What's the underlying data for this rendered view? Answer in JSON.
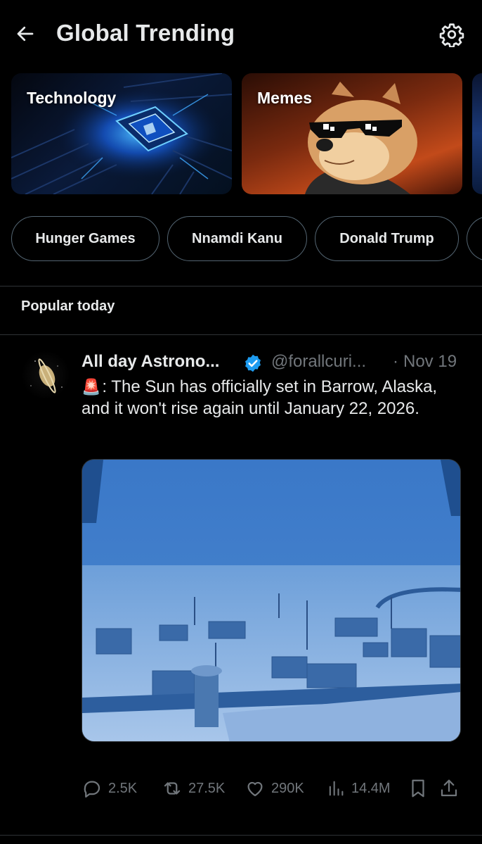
{
  "header": {
    "title": "Global Trending",
    "back_icon": "arrow-left-icon",
    "settings_icon": "gear-icon"
  },
  "topic_cards": [
    {
      "label": "Technology"
    },
    {
      "label": "Memes"
    }
  ],
  "chips": [
    {
      "label": "Hunger Games"
    },
    {
      "label": "Nnamdi Kanu"
    },
    {
      "label": "Donald Trump"
    }
  ],
  "section": {
    "title": "Popular today"
  },
  "tweet": {
    "author_name": "All day Astrono...",
    "handle": "@forallcuri...",
    "separator": "·",
    "date": "Nov 19",
    "text_emoji": "🚨",
    "text": ": The Sun has officially set in Barrow, Alaska, and it won't rise again until January 22, 2026.",
    "verified_color": "#1d9bf0",
    "actions": {
      "replies": "2.5K",
      "reposts": "27.5K",
      "likes": "290K",
      "views": "14.4M"
    }
  },
  "colors": {
    "background": "#000000",
    "text_primary": "#e7e9ea",
    "text_secondary": "#71767b",
    "border": "#2f3336"
  }
}
